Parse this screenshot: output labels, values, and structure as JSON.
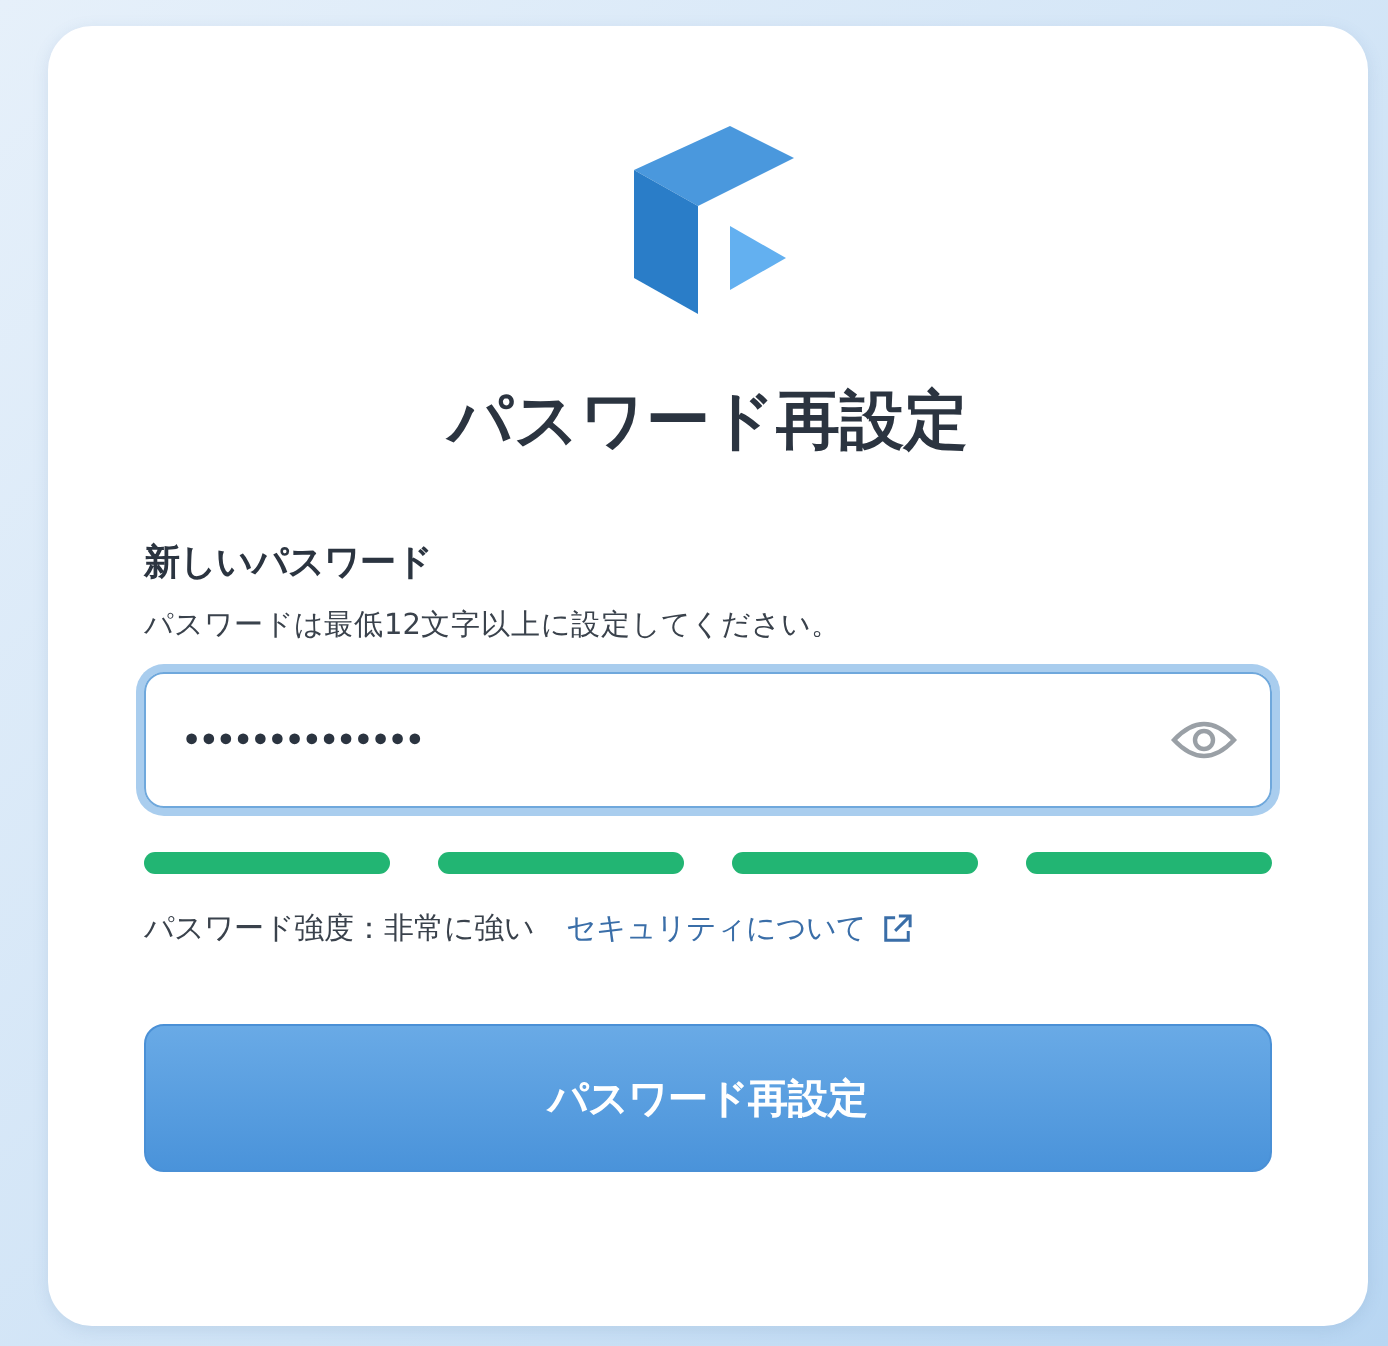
{
  "title": "パスワード再設定",
  "field": {
    "label": "新しいパスワード",
    "hint": "パスワードは最低12文字以上に設定してください。",
    "value": "••••••••••••••",
    "focused": true
  },
  "strength": {
    "segments": [
      {
        "on": true
      },
      {
        "on": true
      },
      {
        "on": true
      },
      {
        "on": true
      }
    ],
    "text": "パスワード強度：非常に強い",
    "link": "セキュリティについて"
  },
  "button": "パスワード再設定"
}
